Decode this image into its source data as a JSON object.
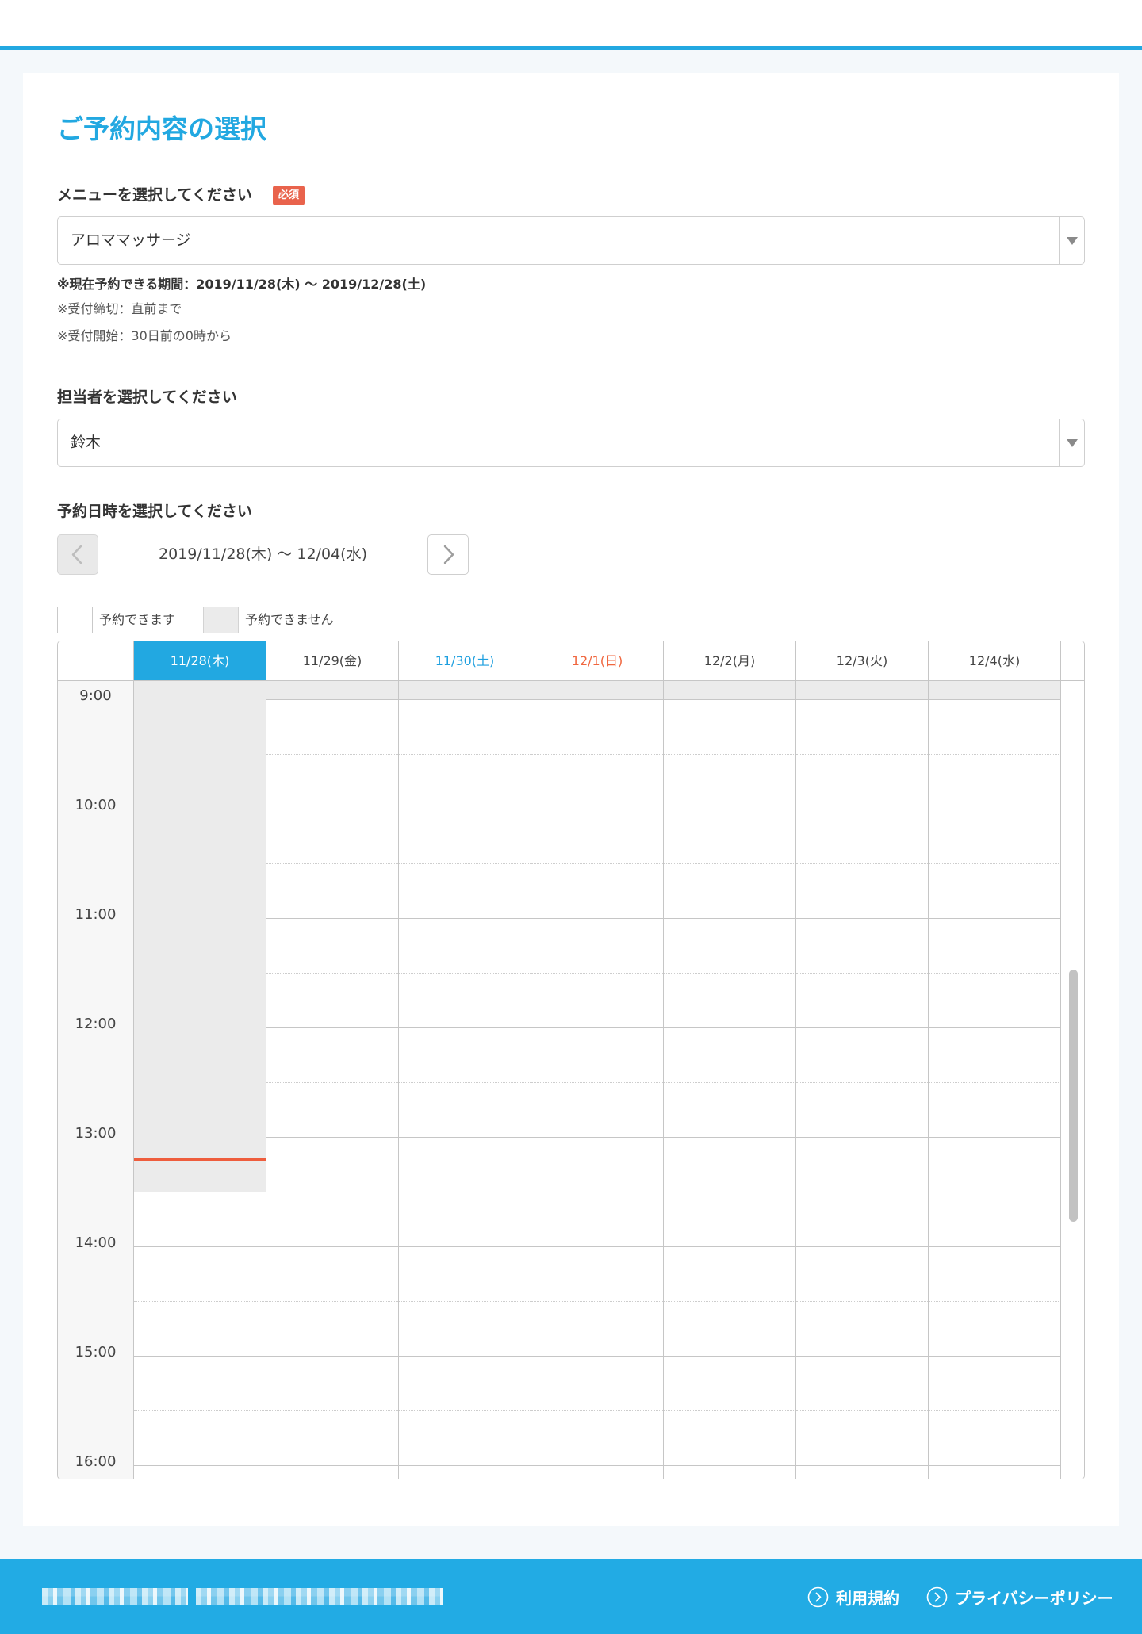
{
  "colors": {
    "accent": "#22a8e1",
    "required": "#e9634c",
    "saturday": "#1d9fdf",
    "sunday": "#f0663e",
    "unavailable": "#ebebeb",
    "now_line": "#ee5d3d",
    "footer": "#22abe4"
  },
  "page": {
    "title": "ご予約内容の選択"
  },
  "menu": {
    "label": "メニューを選択してください",
    "required_badge": "必須",
    "selected": "アロママッサージ",
    "dropdown_icon": "triangle-down-icon",
    "notes": [
      "※現在予約できる期間：2019/11/28(木) 〜 2019/12/28(土)",
      "※受付締切：直前まで",
      "※受付開始：30日前の0時から"
    ]
  },
  "staff": {
    "label": "担当者を選択してください",
    "selected": "鈴木",
    "dropdown_icon": "triangle-down-icon"
  },
  "schedule": {
    "label": "予約日時を選択してください",
    "range": "2019/11/28(木) 〜 12/04(水)",
    "prev_icon": "chevron-left-icon",
    "next_icon": "chevron-right-icon",
    "legend": [
      {
        "label": "予約できます",
        "state": "available"
      },
      {
        "label": "予約できません",
        "state": "unavailable"
      }
    ],
    "days": [
      {
        "label": "11/28(木)",
        "style": "highlight"
      },
      {
        "label": "11/29(金)",
        "style": "weekday"
      },
      {
        "label": "11/30(土)",
        "style": "saturday"
      },
      {
        "label": "12/1(日)",
        "style": "sunday"
      },
      {
        "label": "12/2(月)",
        "style": "weekday"
      },
      {
        "label": "12/3(火)",
        "style": "weekday"
      },
      {
        "label": "12/4(水)",
        "style": "weekday"
      }
    ],
    "hours": [
      "9:00",
      "10:00",
      "11:00",
      "12:00",
      "13:00",
      "14:00",
      "15:00",
      "16:00"
    ],
    "availability": [
      [
        false,
        false,
        false,
        false,
        false,
        false,
        false,
        false,
        false,
        false,
        true,
        true,
        true,
        true,
        true,
        true
      ],
      [
        false,
        true,
        true,
        true,
        true,
        true,
        true,
        true,
        true,
        true,
        true,
        true,
        true,
        true,
        true,
        true
      ],
      [
        false,
        true,
        true,
        true,
        true,
        true,
        true,
        true,
        true,
        true,
        true,
        true,
        true,
        true,
        true,
        true
      ],
      [
        false,
        true,
        true,
        true,
        true,
        true,
        true,
        true,
        true,
        true,
        true,
        true,
        true,
        true,
        true,
        true
      ],
      [
        false,
        true,
        true,
        true,
        true,
        true,
        true,
        true,
        true,
        true,
        true,
        true,
        true,
        true,
        true,
        true
      ],
      [
        false,
        true,
        true,
        true,
        true,
        true,
        true,
        true,
        true,
        true,
        true,
        true,
        true,
        true,
        true,
        true
      ],
      [
        false,
        true,
        true,
        true,
        true,
        true,
        true,
        true,
        true,
        true,
        true,
        true,
        true,
        true,
        true,
        true
      ]
    ]
  },
  "footer": {
    "links": [
      {
        "label": "利用規約",
        "icon": "circle-chevron-right-icon"
      },
      {
        "label": "プライバシーポリシー",
        "icon": "circle-chevron-right-icon"
      }
    ]
  }
}
